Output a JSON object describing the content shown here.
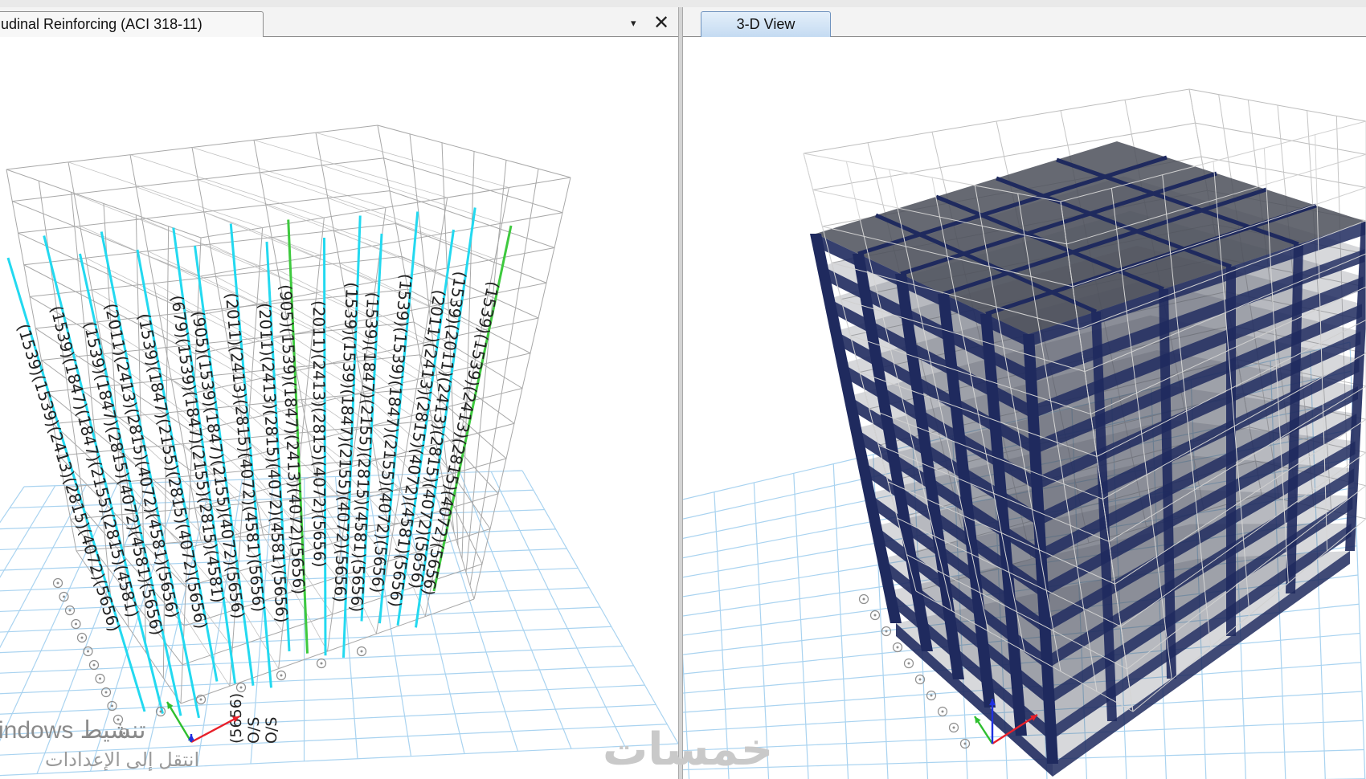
{
  "window": {
    "left_tab_title": "udinal Reinforcing  (ACI 318-11)",
    "right_tab_title": "3-D View",
    "tab_dropdown_glyph": "▾",
    "tab_close_glyph": "✕"
  },
  "icons": {
    "dropdown": "chevron-down-icon",
    "close": "close-icon",
    "axis_triad": "axis-triad-icon"
  },
  "left_view": {
    "column_labels": [
      "(1539)(1539)(2413)(2815)(4072)(5656)",
      "(1539)(1847)(1847)(2155)(2815)(4581)",
      "(1539)(1847)(2815)(4072)(4581)(5656)",
      "(2011)(2413)(2815)(4072)(4581)(5656)",
      "(1539)(1847)(2155)(2815)(4072)(5656)",
      "(679)(1539)(1847)(2155)(2815)(4581)",
      "(905)(1539)(1847)(2155)(4072)(5656)",
      "(2011)(2413)(2815)(4072)(4581)(5656)",
      "(2011)(2413)(2815)(4072)(4581)(5656)",
      "(905)(1539)(1847)(2413)(4072)(5656)",
      "(2011)(2413)(2815)(4072)(5656)",
      "(1539)(1539)(1847)(2155)(4072)(5656)",
      "(1539)(1847)(2155)(2815)(4581)(5656)",
      "(1539)(1539)(1847)(2155)(4072)(5656)",
      "(2011)(2413)(2815)(4072)(4581)(5656)",
      "(1539)(2011)(2413)(2815)(4072)(5656)",
      "(1539)(1539)(2413)(2815)(4072)(5656)"
    ],
    "bottom_labels": [
      "(5656)",
      "O/S",
      "O/S"
    ],
    "axis_colors": {
      "x": "#e8202a",
      "y": "#2fbf2f",
      "z": "#2030e0"
    }
  },
  "colors": {
    "accent_cyan": "#23d9f0",
    "accent_green": "#3ec93e",
    "frame_gray": "#a8a8a8",
    "grid_blue": "#a9d3f0",
    "member_navy": "#1f2a5e",
    "slab_gray": "#4b4f59",
    "tab_active": "#c4dbf2"
  },
  "watermarks": {
    "activate_windows_en": "indows تنشيط",
    "activate_windows_ar": "انتقل إلى الإعدادات",
    "site_logo": "خمسات"
  }
}
